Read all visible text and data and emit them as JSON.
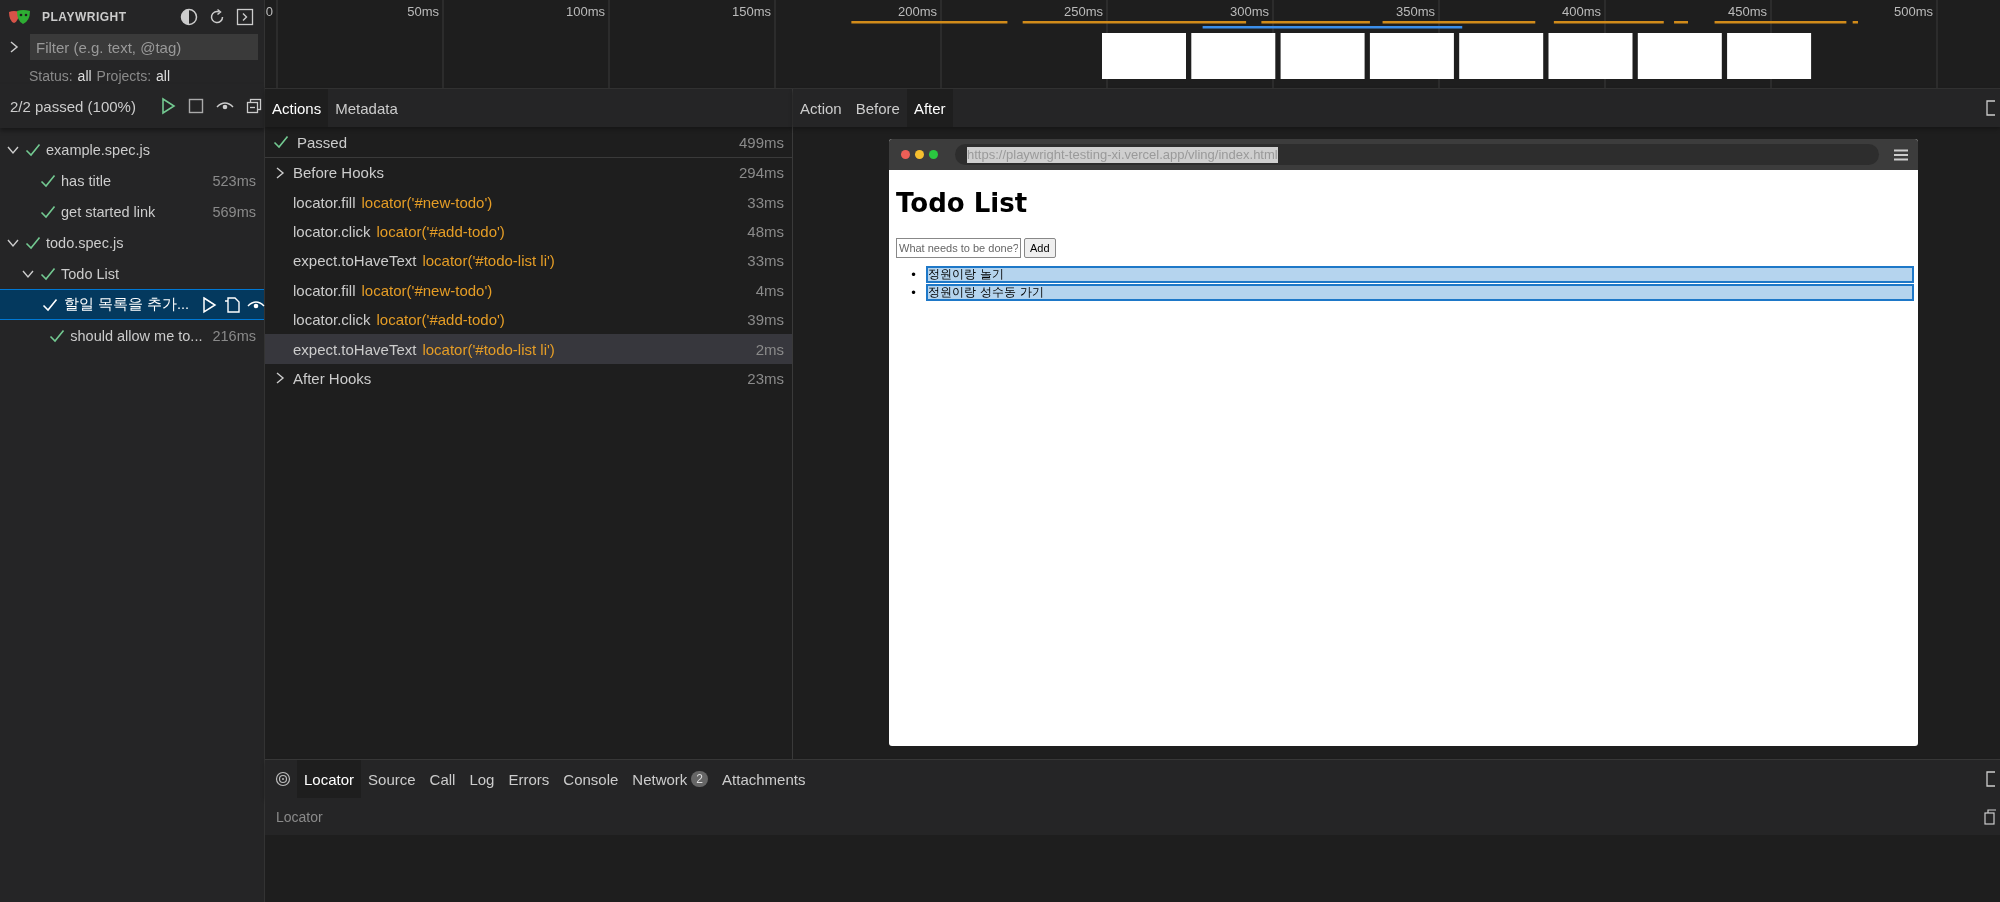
{
  "sidebar": {
    "title": "PLAYWRIGHT",
    "filter": {
      "placeholder": "Filter (e.g. text, @tag)"
    },
    "status_label": "Status:",
    "status_value": "all",
    "projects_label": "Projects:",
    "projects_value": "all",
    "summary": "2/2 passed (100%)",
    "tree": [
      {
        "label": "example.spec.js",
        "expanded": true,
        "selected": false,
        "children": [
          {
            "label": "has title",
            "duration": "523ms",
            "selected": false
          },
          {
            "label": "get started link",
            "duration": "569ms",
            "selected": false
          }
        ]
      },
      {
        "label": "todo.spec.js",
        "expanded": true,
        "selected": false,
        "children": [
          {
            "label": "Todo List",
            "expanded": true,
            "selected": false,
            "children": [
              {
                "label": "할일 목록을 추가...",
                "selected": true
              },
              {
                "label": "should allow me to...",
                "duration": "216ms",
                "selected": false
              }
            ]
          }
        ]
      }
    ]
  },
  "timeline": {
    "ticks": [
      "0",
      "50ms",
      "100ms",
      "150ms",
      "200ms",
      "250ms",
      "300ms",
      "350ms",
      "400ms",
      "450ms",
      "500ms"
    ]
  },
  "actions_panel": {
    "tabs": [
      {
        "label": "Actions",
        "selected": true
      },
      {
        "label": "Metadata",
        "selected": false
      }
    ],
    "result": {
      "label": "Passed",
      "duration": "499ms"
    },
    "items": [
      {
        "kind": "hook",
        "name": "Before Hooks",
        "duration": "294ms",
        "expanded": false,
        "selected": false
      },
      {
        "kind": "action",
        "name": "locator.fill",
        "selector": "locator('#new-todo')",
        "duration": "33ms",
        "selected": false
      },
      {
        "kind": "action",
        "name": "locator.click",
        "selector": "locator('#add-todo')",
        "duration": "48ms",
        "selected": false
      },
      {
        "kind": "action",
        "name": "expect.toHaveText",
        "selector": "locator('#todo-list li')",
        "duration": "33ms",
        "selected": false
      },
      {
        "kind": "action",
        "name": "locator.fill",
        "selector": "locator('#new-todo')",
        "duration": "4ms",
        "selected": false
      },
      {
        "kind": "action",
        "name": "locator.click",
        "selector": "locator('#add-todo')",
        "duration": "39ms",
        "selected": false
      },
      {
        "kind": "action",
        "name": "expect.toHaveText",
        "selector": "locator('#todo-list li')",
        "duration": "2ms",
        "selected": true
      },
      {
        "kind": "hook",
        "name": "After Hooks",
        "duration": "23ms",
        "expanded": false,
        "selected": false
      }
    ]
  },
  "snapshot_panel": {
    "tabs": [
      {
        "label": "Action",
        "selected": false
      },
      {
        "label": "Before",
        "selected": false
      },
      {
        "label": "After",
        "selected": true
      }
    ],
    "browser": {
      "url": "https://playwright-testing-xi.vercel.app/vling/index.html",
      "heading": "Todo List",
      "input": {
        "placeholder": "What needs to be done?"
      },
      "button": "Add",
      "items": [
        {
          "marker": "•",
          "text": "정원이랑 놀기"
        },
        {
          "marker": "•",
          "text": "정원이랑 성수동 가기"
        }
      ]
    }
  },
  "bottom_panel": {
    "tabs": [
      {
        "label": "Locator",
        "selected": true
      },
      {
        "label": "Source",
        "selected": false
      },
      {
        "label": "Call",
        "selected": false
      },
      {
        "label": "Log",
        "selected": false
      },
      {
        "label": "Errors",
        "selected": false
      },
      {
        "label": "Console",
        "selected": false
      },
      {
        "label": "Network",
        "selected": false,
        "badge": "2"
      },
      {
        "label": "Attachments",
        "selected": false
      }
    ],
    "section_label": "Locator"
  }
}
